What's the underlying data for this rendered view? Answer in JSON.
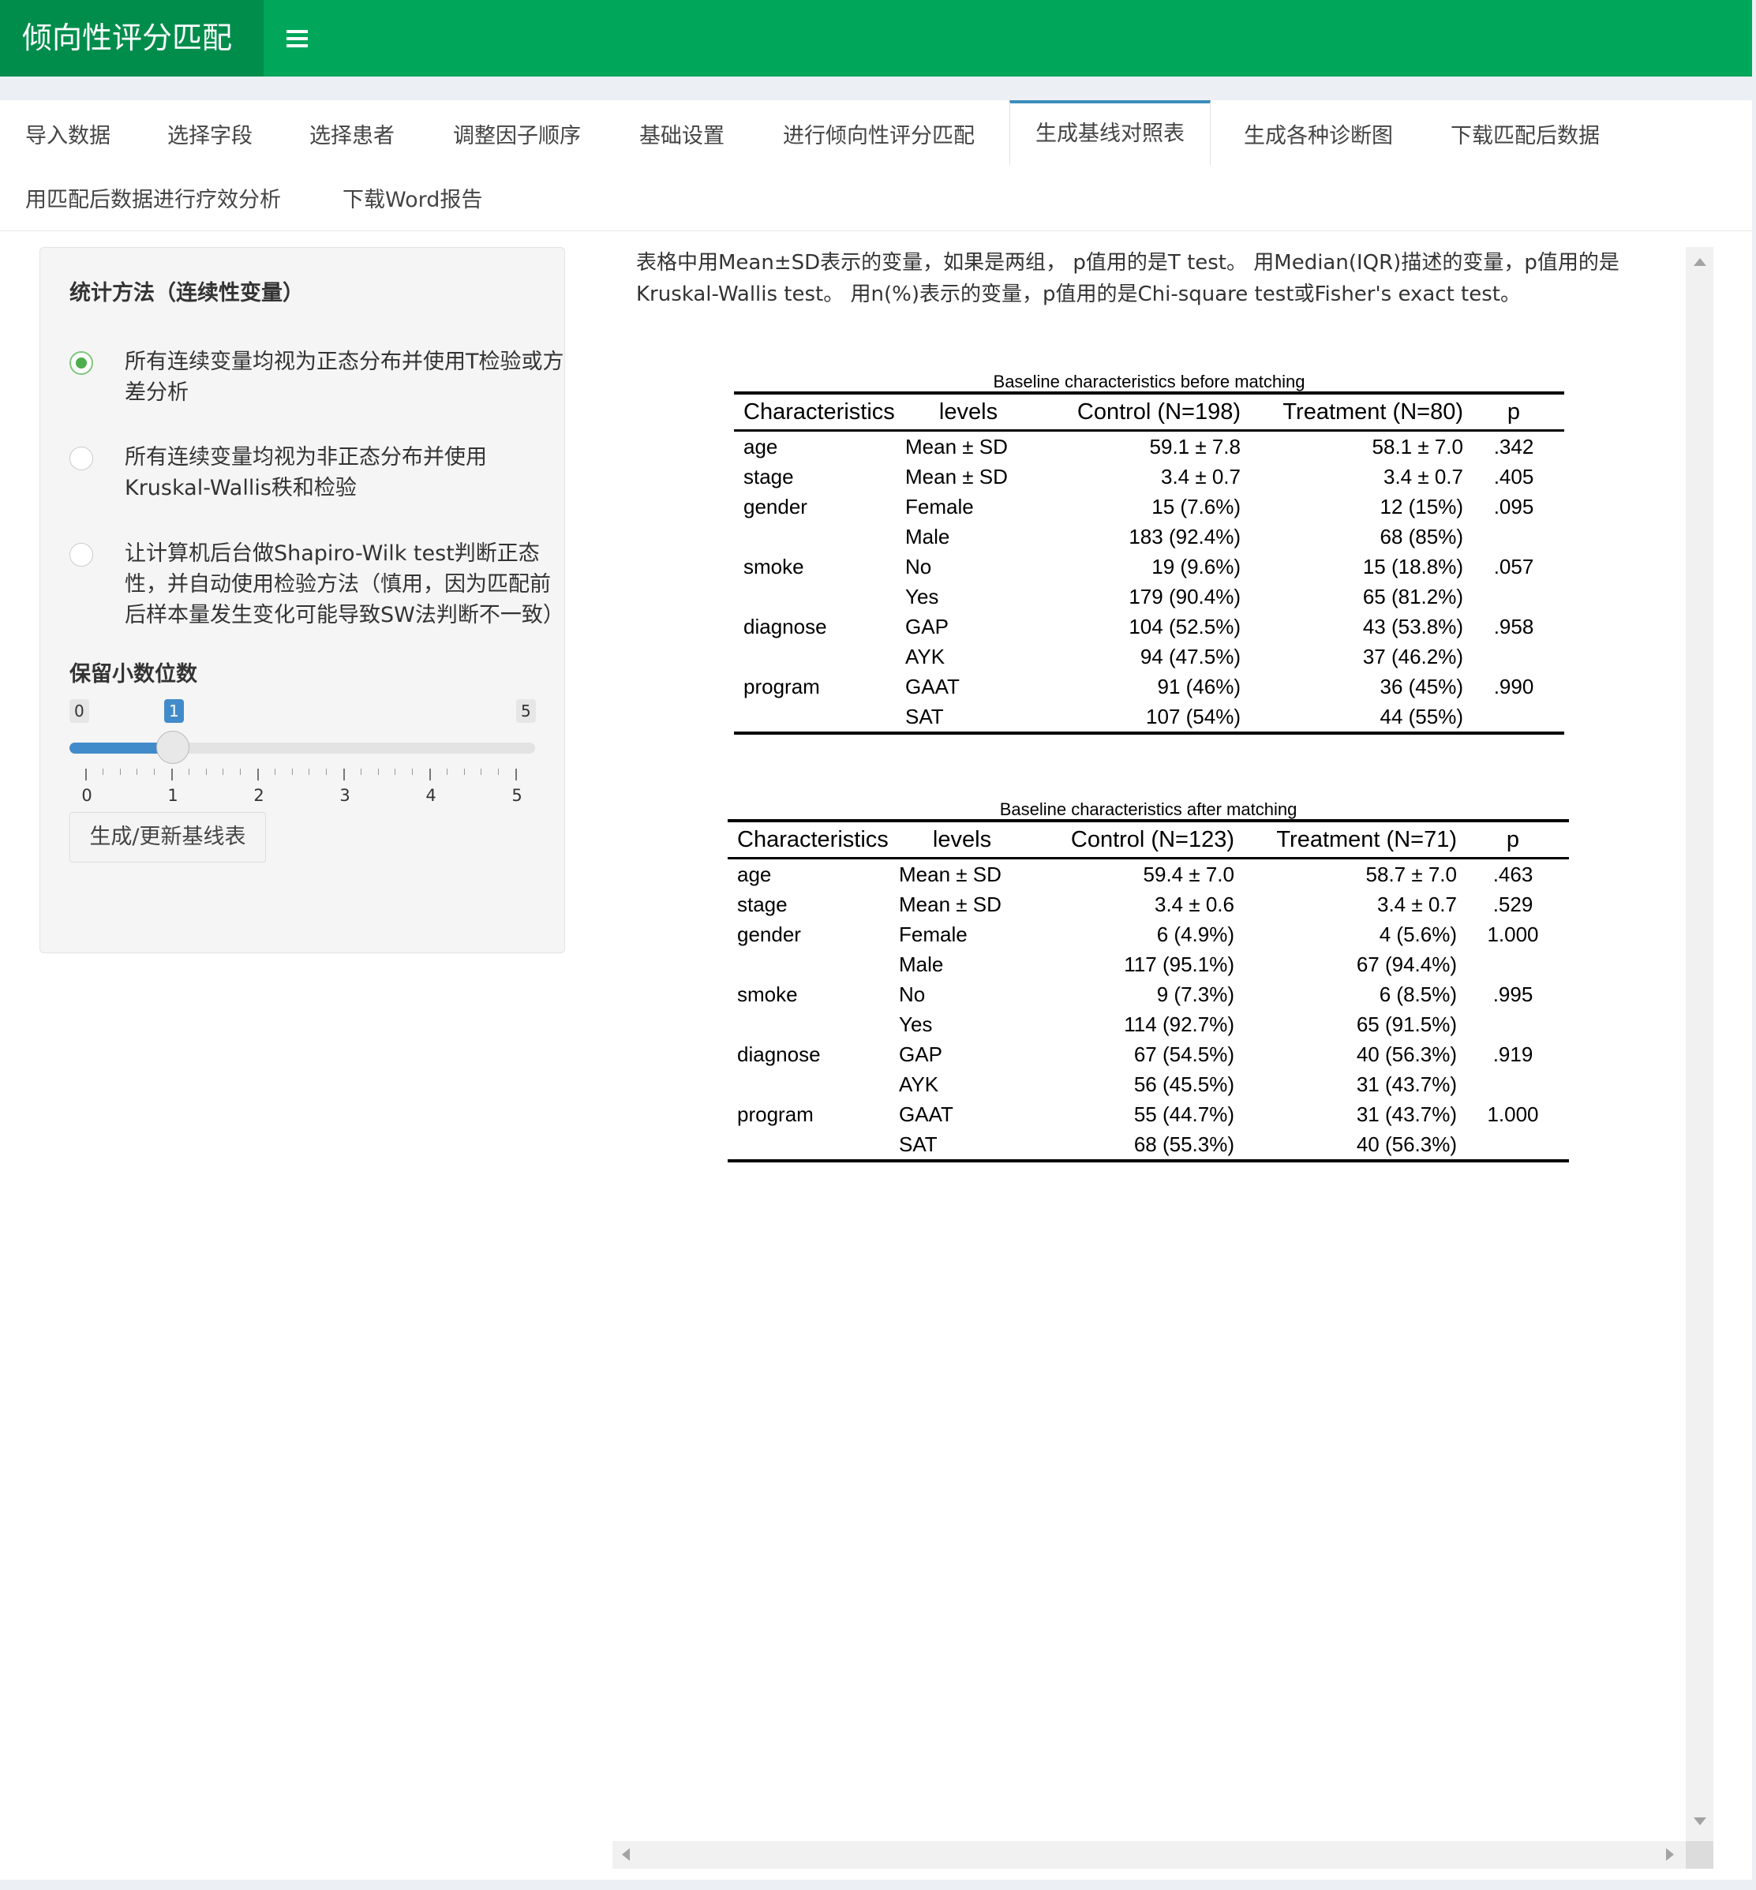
{
  "header": {
    "title": "倾向性评分匹配"
  },
  "tabs": [
    {
      "label": "导入数据"
    },
    {
      "label": "选择字段"
    },
    {
      "label": "选择患者"
    },
    {
      "label": "调整因子顺序"
    },
    {
      "label": "基础设置"
    },
    {
      "label": "进行倾向性评分匹配"
    },
    {
      "label": "生成基线对照表",
      "active": true
    },
    {
      "label": "生成各种诊断图"
    },
    {
      "label": "下载匹配后数据"
    },
    {
      "label": "用匹配后数据进行疗效分析"
    },
    {
      "label": "下载Word报告"
    }
  ],
  "sidebar": {
    "method_title": "统计方法（连续性变量）",
    "options": [
      {
        "label": "所有连续变量均视为正态分布并使用T检验或方差分析",
        "selected": true
      },
      {
        "label": "所有连续变量均视为非正态分布并使用Kruskal-Wallis秩和检验",
        "selected": false
      },
      {
        "label": "让计算机后台做Shapiro-Wilk test判断正态性，并自动使用检验方法（慎用，因为匹配前后样本量发生变化可能导致SW法判断不一致）",
        "selected": false
      }
    ],
    "decimals_label": "保留小数位数",
    "slider": {
      "min": "0",
      "max": "5",
      "value": "1",
      "ticks": [
        "0",
        "1",
        "2",
        "3",
        "4",
        "5"
      ]
    },
    "generate_button": "生成/更新基线表"
  },
  "main": {
    "note": "表格中用Mean±SD表示的变量，如果是两组， p值用的是T test。 用Median(IQR)描述的变量，p值用的是Kruskal-Wallis test。 用n(%)表示的变量，p值用的是Chi-square test或Fisher's exact test。"
  },
  "tables": [
    {
      "caption": "Baseline characteristics before matching",
      "headers": [
        "Characteristics",
        "levels",
        "Control (N=198)",
        "Treatment (N=80)",
        "p"
      ],
      "rows": [
        [
          "age",
          "Mean ± SD",
          "59.1 ± 7.8",
          "58.1 ± 7.0",
          ".342"
        ],
        [
          "stage",
          "Mean ± SD",
          "3.4 ± 0.7",
          "3.4 ± 0.7",
          ".405"
        ],
        [
          "gender",
          "Female",
          "15 (7.6%)",
          "12 (15%)",
          ".095"
        ],
        [
          "",
          "Male",
          "183 (92.4%)",
          "68 (85%)",
          ""
        ],
        [
          "smoke",
          "No",
          "19 (9.6%)",
          "15 (18.8%)",
          ".057"
        ],
        [
          "",
          "Yes",
          "179 (90.4%)",
          "65 (81.2%)",
          ""
        ],
        [
          "diagnose",
          "GAP",
          "104 (52.5%)",
          "43 (53.8%)",
          ".958"
        ],
        [
          "",
          "AYK",
          "94 (47.5%)",
          "37 (46.2%)",
          ""
        ],
        [
          "program",
          "GAAT",
          "91 (46%)",
          "36 (45%)",
          ".990"
        ],
        [
          "",
          "SAT",
          "107 (54%)",
          "44 (55%)",
          ""
        ]
      ]
    },
    {
      "caption": "Baseline characteristics after matching",
      "headers": [
        "Characteristics",
        "levels",
        "Control (N=123)",
        "Treatment (N=71)",
        "p"
      ],
      "rows": [
        [
          "age",
          "Mean ± SD",
          "59.4 ± 7.0",
          "58.7 ± 7.0",
          ".463"
        ],
        [
          "stage",
          "Mean ± SD",
          "3.4 ± 0.6",
          "3.4 ± 0.7",
          ".529"
        ],
        [
          "gender",
          "Female",
          "6 (4.9%)",
          "4 (5.6%)",
          "1.000"
        ],
        [
          "",
          "Male",
          "117 (95.1%)",
          "67 (94.4%)",
          ""
        ],
        [
          "smoke",
          "No",
          "9 (7.3%)",
          "6 (8.5%)",
          ".995"
        ],
        [
          "",
          "Yes",
          "114 (92.7%)",
          "65 (91.5%)",
          ""
        ],
        [
          "diagnose",
          "GAP",
          "67 (54.5%)",
          "40 (56.3%)",
          ".919"
        ],
        [
          "",
          "AYK",
          "56 (45.5%)",
          "31 (43.7%)",
          ""
        ],
        [
          "program",
          "GAAT",
          "55 (44.7%)",
          "31 (43.7%)",
          "1.000"
        ],
        [
          "",
          "SAT",
          "68 (55.3%)",
          "40 (56.3%)",
          ""
        ]
      ]
    }
  ]
}
